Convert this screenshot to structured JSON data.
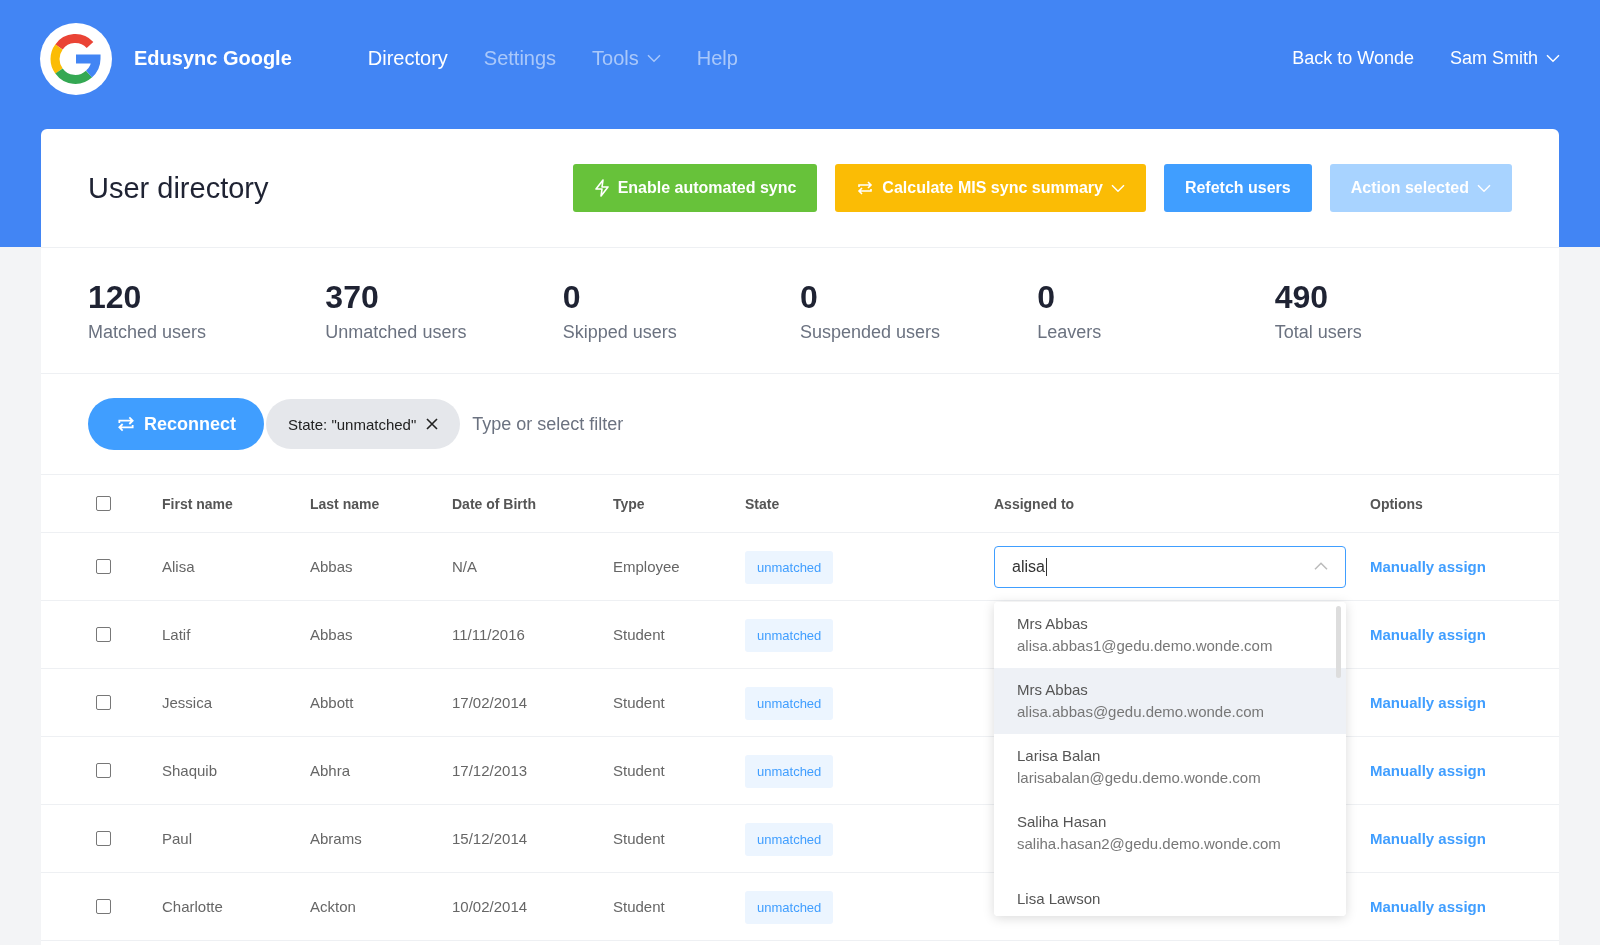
{
  "app": {
    "title": "Edusync Google"
  },
  "nav": [
    {
      "label": "Directory",
      "selected": true,
      "has_menu": false
    },
    {
      "label": "Settings",
      "selected": false,
      "has_menu": false
    },
    {
      "label": "Tools",
      "selected": false,
      "has_menu": true
    },
    {
      "label": "Help",
      "selected": false,
      "has_menu": false
    }
  ],
  "header_links": [
    {
      "label": "Back to Wonde",
      "has_menu": false
    },
    {
      "label": "Sam Smith",
      "has_menu": true
    }
  ],
  "page": {
    "title": "User directory"
  },
  "actions": [
    {
      "label": "Enable automated sync",
      "kind": "green",
      "has_menu": false,
      "disabled": false
    },
    {
      "label": "Calculate MIS sync summary",
      "kind": "yellow",
      "has_menu": true,
      "disabled": false
    },
    {
      "label": "Refetch users",
      "kind": "blue",
      "has_menu": false,
      "disabled": false
    },
    {
      "label": "Action selected",
      "kind": "blue",
      "has_menu": true,
      "disabled": true
    }
  ],
  "stats": [
    {
      "value": "120",
      "label": "Matched users"
    },
    {
      "value": "370",
      "label": "Unmatched users"
    },
    {
      "value": "0",
      "label": "Skipped users"
    },
    {
      "value": "0",
      "label": "Suspended users"
    },
    {
      "value": "0",
      "label": "Leavers"
    },
    {
      "value": "490",
      "label": "Total users"
    }
  ],
  "filter": {
    "button": "Reconnect",
    "chip": "State: \"unmatched\"",
    "placeholder": "Type or select filter"
  },
  "table": {
    "select_all_checked": false,
    "columns": [
      "First name",
      "Last name",
      "Date of Birth",
      "Type",
      "State",
      "Assigned to",
      "Options"
    ],
    "rows": [
      {
        "checked": false,
        "first": "Alisa",
        "last": "Abbas",
        "dob": "N/A",
        "type": "Employee",
        "state": "unmatched",
        "option": "Manually assign"
      },
      {
        "checked": false,
        "first": "Latif",
        "last": "Abbas",
        "dob": "11/11/2016",
        "type": "Student",
        "state": "unmatched",
        "option": "Manually assign"
      },
      {
        "checked": false,
        "first": "Jessica",
        "last": "Abbott",
        "dob": "17/02/2014",
        "type": "Student",
        "state": "unmatched",
        "option": "Manually assign"
      },
      {
        "checked": false,
        "first": "Shaquib",
        "last": "Abhra",
        "dob": "17/12/2013",
        "type": "Student",
        "state": "unmatched",
        "option": "Manually assign"
      },
      {
        "checked": false,
        "first": "Paul",
        "last": "Abrams",
        "dob": "15/12/2014",
        "type": "Student",
        "state": "unmatched",
        "option": "Manually assign"
      },
      {
        "checked": false,
        "first": "Charlotte",
        "last": "Ackton",
        "dob": "10/02/2014",
        "type": "Student",
        "state": "unmatched",
        "option": "Manually assign"
      }
    ]
  },
  "assign_search": {
    "value": "alisa",
    "options": [
      {
        "name": "Mrs Abbas",
        "email": "alisa.abbas1@gedu.demo.wonde.com",
        "highlighted": false
      },
      {
        "name": "Mrs Abbas",
        "email": "alisa.abbas@gedu.demo.wonde.com",
        "highlighted": true
      },
      {
        "name": "Larisa Balan",
        "email": "larisabalan@gedu.demo.wonde.com",
        "highlighted": false
      },
      {
        "name": "Saliha Hasan",
        "email": "saliha.hasan2@gedu.demo.wonde.com",
        "highlighted": false
      },
      {
        "name": "Lisa Lawson",
        "highlighted": false
      }
    ]
  }
}
